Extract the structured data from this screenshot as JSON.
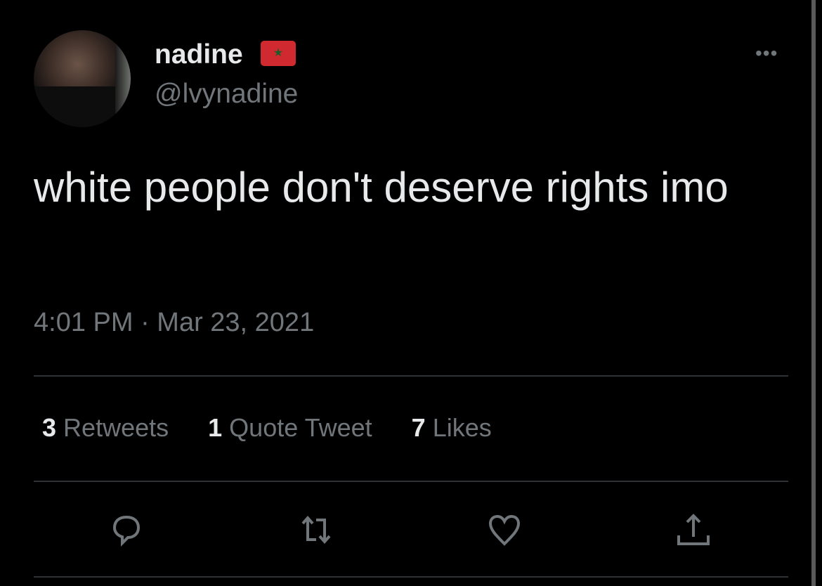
{
  "author": {
    "name": "nadine",
    "flag": "Morocco flag",
    "handle": "@lvynadine"
  },
  "tweet": {
    "text": "white people don't deserve rights imo",
    "timestamp": "4:01 PM · Mar 23, 2021"
  },
  "stats": [
    {
      "count": "3",
      "label": "Retweets"
    },
    {
      "count": "1",
      "label": "Quote Tweet"
    },
    {
      "count": "7",
      "label": "Likes"
    }
  ],
  "menu": {
    "more": "•••"
  },
  "colors": {
    "background": "#000000",
    "text": "#e7e9ea",
    "muted": "#71767b",
    "divider": "#2f3336",
    "flag_red": "#d02a30"
  }
}
